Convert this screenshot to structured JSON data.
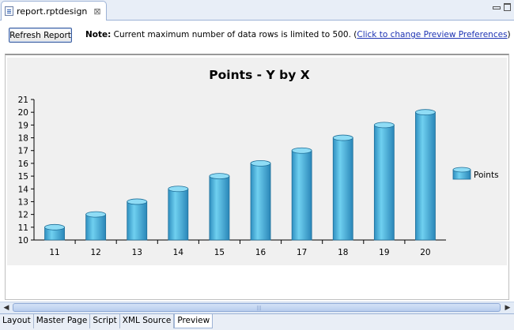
{
  "editor": {
    "tab_title": "report.rptdesign",
    "close_glyph": "⊠"
  },
  "toolbar": {
    "refresh_label": "Refresh Report",
    "note_label": "Note:",
    "note_text": " Current maximum number of data rows is limited to 500. (",
    "note_link": "Click to change Preview Preferences",
    "note_end": ")"
  },
  "chart_data": {
    "type": "bar",
    "title": "Points - Y by X",
    "categories": [
      "11",
      "12",
      "13",
      "14",
      "15",
      "16",
      "17",
      "18",
      "19",
      "20"
    ],
    "series": [
      {
        "name": "Points",
        "values": [
          11,
          12,
          13,
          14,
          15,
          16,
          17,
          18,
          19,
          20
        ]
      }
    ],
    "yticks": [
      10,
      11,
      12,
      13,
      14,
      15,
      16,
      17,
      18,
      19,
      20,
      21
    ],
    "ylim": [
      10,
      21
    ],
    "legend": "right",
    "bar_style": "cylinder",
    "colors": {
      "bar": "#4fb6dc",
      "bar_top": "#8fdcf5",
      "background": "#f0f0f0"
    }
  },
  "bottom_tabs": [
    {
      "label": "Layout",
      "active": false
    },
    {
      "label": "Master Page",
      "active": false
    },
    {
      "label": "Script",
      "active": false
    },
    {
      "label": "XML Source",
      "active": false
    },
    {
      "label": "Preview",
      "active": true
    }
  ],
  "scroll": {
    "left_arrow": "◀",
    "right_arrow": "▶",
    "grip": "|||"
  }
}
